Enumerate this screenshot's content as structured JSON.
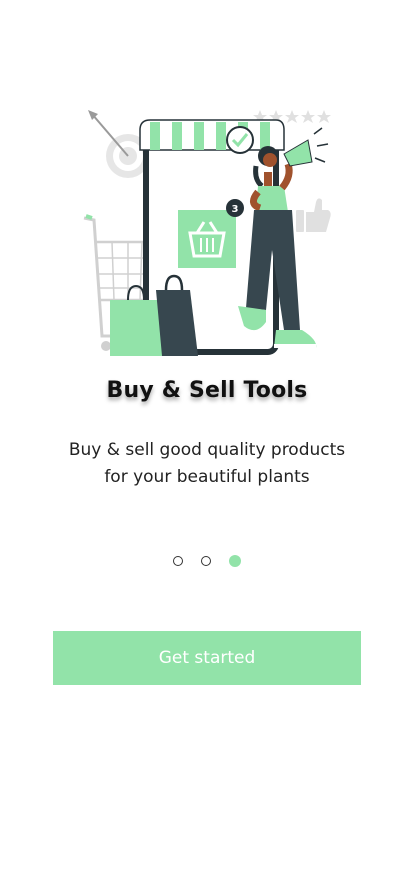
{
  "onboarding": {
    "illustration_name": "shopping-illustration",
    "title": "Buy & Sell Tools",
    "subtitle_line1": "Buy & sell good quality products",
    "subtitle_line2": "for your beautiful plants",
    "badge_count": "3",
    "dots": [
      {
        "active": false
      },
      {
        "active": false
      },
      {
        "active": true
      }
    ],
    "cta_label": "Get started"
  },
  "colors": {
    "accent": "#92e3a9",
    "dark": "#263238",
    "gray": "#d9d9d9",
    "background": "#ffffff"
  }
}
